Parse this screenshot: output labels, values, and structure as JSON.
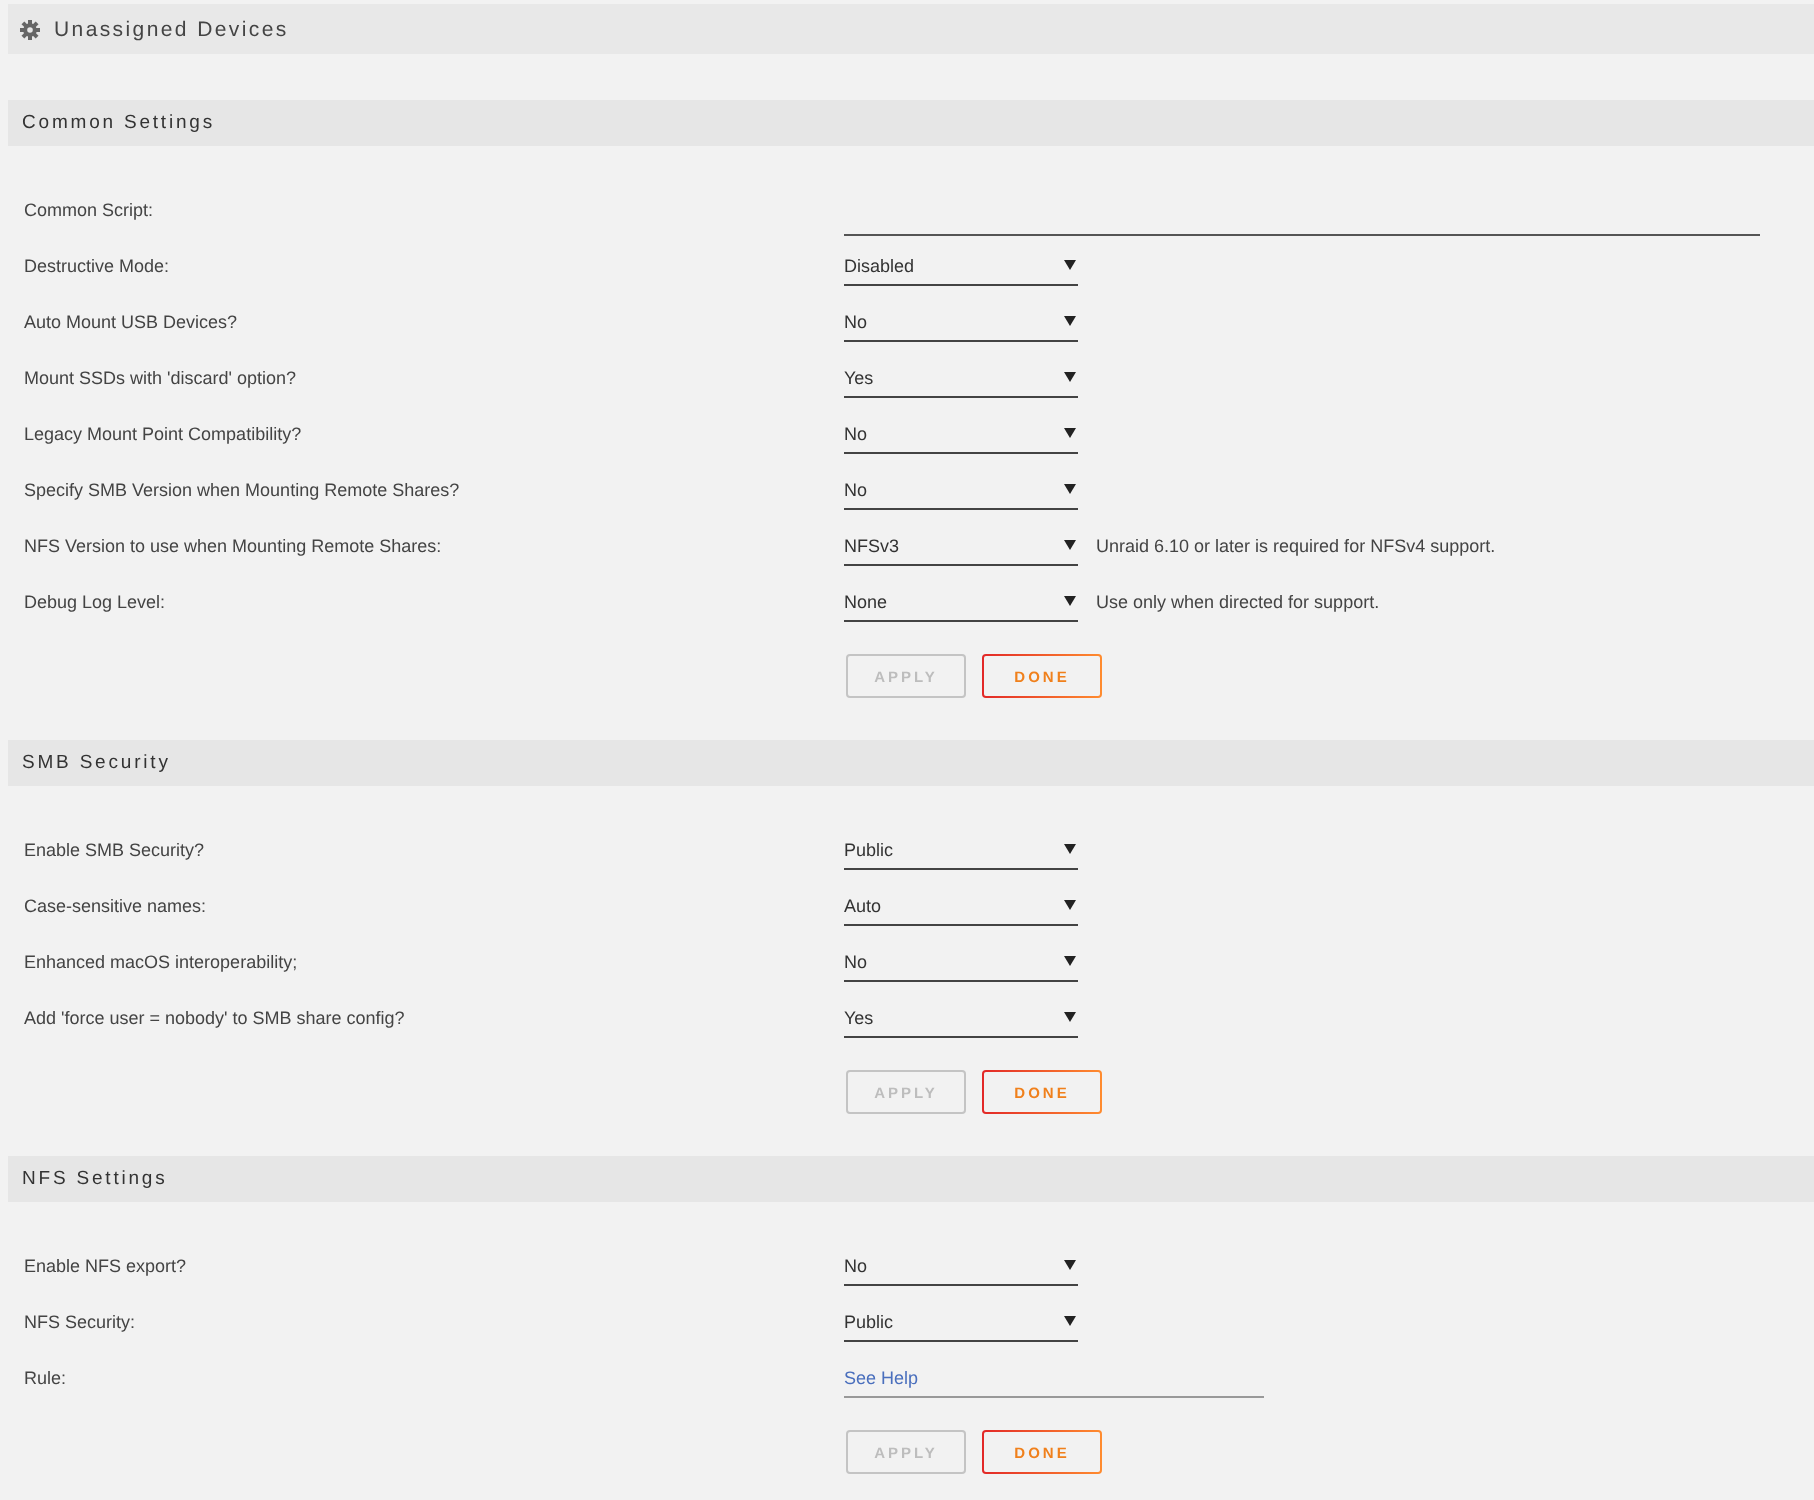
{
  "title": "Unassigned Devices",
  "sections": [
    {
      "title": "Common Settings",
      "rows": [
        {
          "kind": "text",
          "label": "Common Script:"
        },
        {
          "kind": "select",
          "label": "Destructive Mode:",
          "value": "Disabled"
        },
        {
          "kind": "select",
          "label": "Auto Mount USB Devices?",
          "value": "No"
        },
        {
          "kind": "select",
          "label": "Mount SSDs with 'discard' option?",
          "value": "Yes"
        },
        {
          "kind": "select",
          "label": "Legacy Mount Point Compatibility?",
          "value": "No"
        },
        {
          "kind": "select",
          "label": "Specify SMB Version when Mounting Remote Shares?",
          "value": "No"
        },
        {
          "kind": "select",
          "label": "NFS Version to use when Mounting Remote Shares:",
          "value": "NFSv3",
          "note": "Unraid 6.10 or later is required for NFSv4 support."
        },
        {
          "kind": "select",
          "label": "Debug Log Level:",
          "value": "None",
          "note": "Use only when directed for support."
        }
      ],
      "buttons": [
        {
          "label": "APPLY",
          "disabled": true
        },
        {
          "label": "DONE",
          "disabled": false
        }
      ]
    },
    {
      "title": "SMB Security",
      "rows": [
        {
          "kind": "select",
          "label": "Enable SMB Security?",
          "value": "Public"
        },
        {
          "kind": "select",
          "label": "Case-sensitive names:",
          "value": "Auto"
        },
        {
          "kind": "select",
          "label": "Enhanced macOS interoperability;",
          "value": "No"
        },
        {
          "kind": "select",
          "label": "Add 'force user = nobody' to SMB share config?",
          "value": "Yes"
        }
      ],
      "buttons": [
        {
          "label": "APPLY",
          "disabled": true
        },
        {
          "label": "DONE",
          "disabled": false
        }
      ]
    },
    {
      "title": "NFS Settings",
      "rows": [
        {
          "kind": "select",
          "label": "Enable NFS export?",
          "value": "No"
        },
        {
          "kind": "select",
          "label": "NFS Security:",
          "value": "Public"
        },
        {
          "kind": "link",
          "label": "Rule:",
          "value": "See Help"
        }
      ],
      "buttons": [
        {
          "label": "APPLY",
          "disabled": true
        },
        {
          "label": "DONE",
          "disabled": false
        }
      ]
    }
  ]
}
